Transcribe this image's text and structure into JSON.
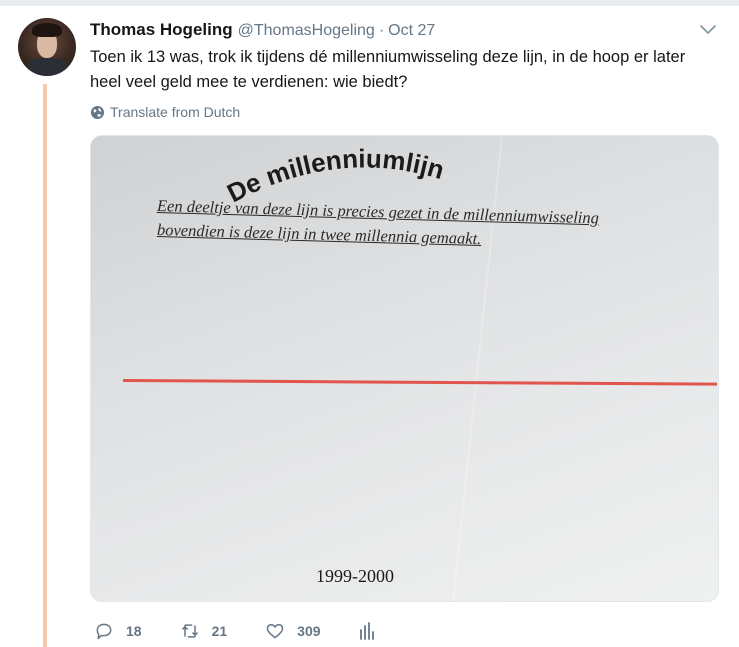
{
  "tweet": {
    "author_name": "Thomas Hogeling",
    "handle": "@ThomasHogeling",
    "separator": "·",
    "timestamp": "Oct 27",
    "text": "Toen ik 13 was, trok ik tijdens dé millenniumwisseling deze lijn, in de hoop er later heel veel geld mee te verdienen: wie biedt?",
    "translate_label": "Translate from Dutch"
  },
  "media": {
    "title": "De millenniumlijn",
    "line1": "Een deeltje van deze lijn is precies gezet in de millenniumwisseling",
    "line2": "bovendien is deze lijn in twee millennia gemaakt.",
    "year": "1999-2000",
    "line_color": "#e0554d"
  },
  "actions": {
    "reply_count": "18",
    "retweet_count": "21",
    "like_count": "309"
  },
  "colors": {
    "thread_line": "#f5c9b0",
    "muted": "#657786",
    "text": "#14171a"
  }
}
